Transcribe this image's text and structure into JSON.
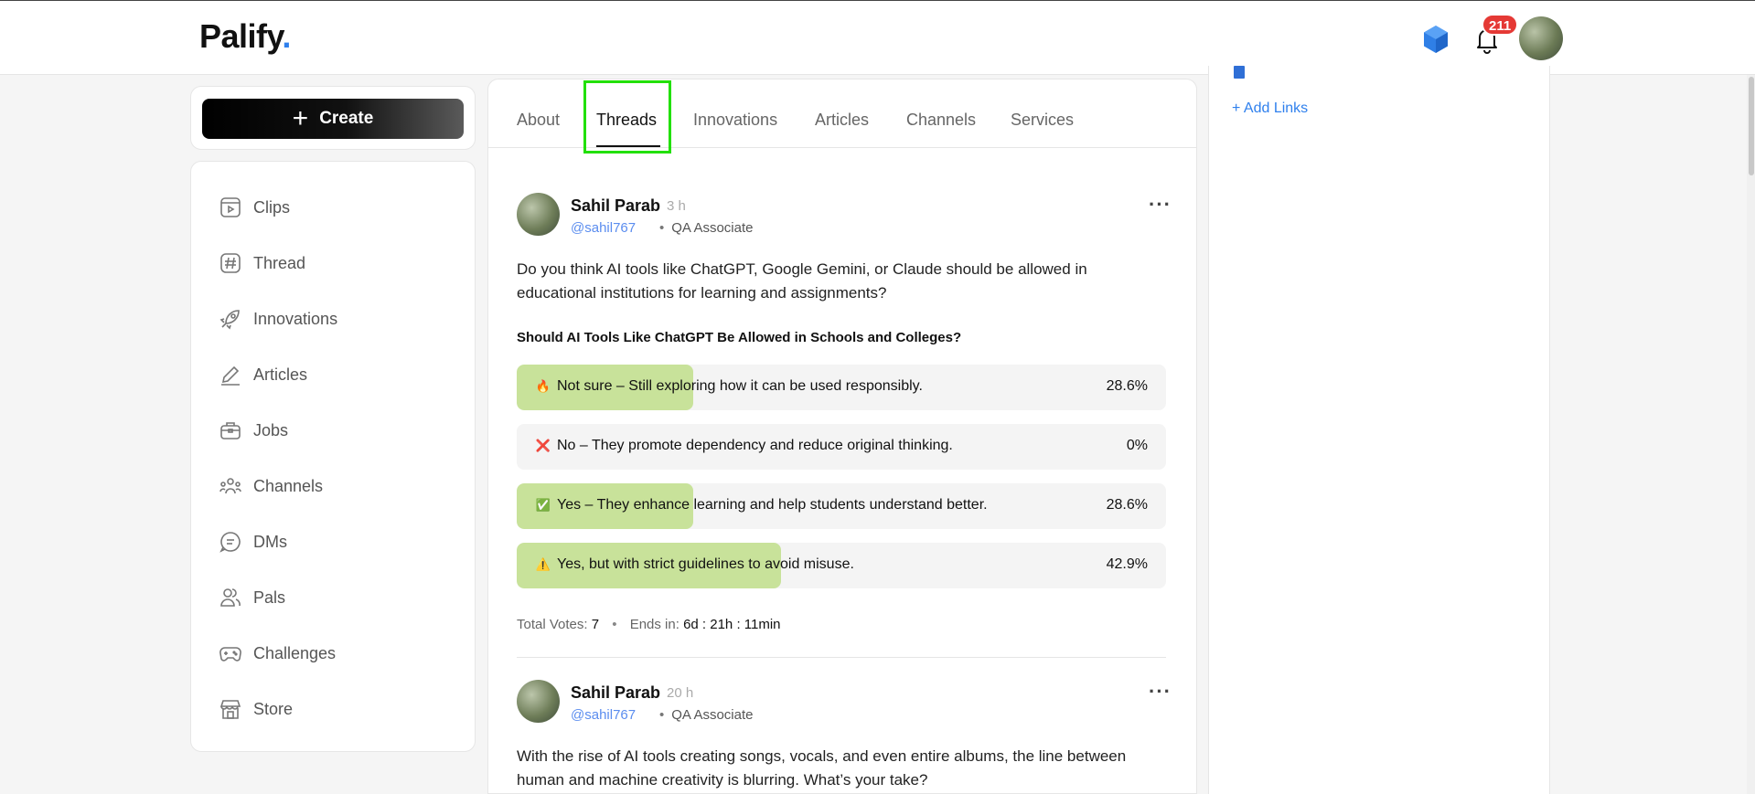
{
  "header": {
    "logo": "Palify",
    "logo_dot": ".",
    "notification_count": "211"
  },
  "sidebar": {
    "create_label": "Create",
    "items": [
      {
        "label": "Clips",
        "icon": "clips-icon"
      },
      {
        "label": "Thread",
        "icon": "hash-icon"
      },
      {
        "label": "Innovations",
        "icon": "rocket-icon"
      },
      {
        "label": "Articles",
        "icon": "pen-icon"
      },
      {
        "label": "Jobs",
        "icon": "briefcase-icon"
      },
      {
        "label": "Channels",
        "icon": "people-icon"
      },
      {
        "label": "DMs",
        "icon": "chat-icon"
      },
      {
        "label": "Pals",
        "icon": "pals-icon"
      },
      {
        "label": "Challenges",
        "icon": "gamepad-icon"
      },
      {
        "label": "Store",
        "icon": "store-icon"
      }
    ]
  },
  "tabs": [
    "About",
    "Threads",
    "Innovations",
    "Articles",
    "Channels",
    "Services"
  ],
  "active_tab": "Threads",
  "posts": [
    {
      "author": "Sahil Parab",
      "time": "3 h",
      "handle": "@sahil767",
      "role": "QA Associate",
      "text": "Do you think AI tools like ChatGPT, Google Gemini, or Claude should be allowed in educational institutions for learning and assignments?",
      "poll": {
        "question": "Should AI Tools Like ChatGPT Be Allowed in Schools and Colleges?",
        "options": [
          {
            "emoji": "🔥",
            "label": "Not sure – Still exploring how it can be used responsibly.",
            "pct": "28.6%",
            "value": 28.6
          },
          {
            "emoji": "❌",
            "label": "No – They promote dependency and reduce original thinking.",
            "pct": "0%",
            "value": 0
          },
          {
            "emoji": "✅",
            "label": "Yes – They enhance learning and help students understand better.",
            "pct": "28.6%",
            "value": 28.6
          },
          {
            "emoji": "⚠️",
            "label": "Yes, but with strict guidelines to avoid misuse.",
            "pct": "42.9%",
            "value": 42.9
          }
        ],
        "total_votes_label": "Total Votes:",
        "total_votes": "7",
        "ends_label": "Ends in:",
        "ends_value": "6d : 21h : 11min"
      }
    },
    {
      "author": "Sahil Parab",
      "time": "20 h",
      "handle": "@sahil767",
      "role": "QA Associate",
      "text": "With the rise of AI tools creating songs, vocals, and even entire albums, the line between human and machine creativity is blurring. What’s your take?"
    }
  ],
  "right_panel": {
    "add_links": "+ Add Links"
  },
  "colors": {
    "accent": "#2f80ed",
    "poll_fill": "#c8e29a",
    "badge": "#e53935",
    "highlight": "#22e000"
  }
}
